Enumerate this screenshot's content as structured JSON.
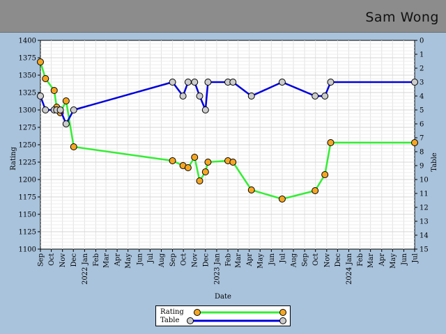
{
  "header": {
    "title": "Sam Wong"
  },
  "chart_data": {
    "type": "line",
    "xlabel": "Date",
    "ylabel_left": "Rating",
    "ylabel_right": "Table",
    "ylim_left": [
      1100,
      1400
    ],
    "ylim_right": [
      15,
      0
    ],
    "y_ticks_left": [
      "1100",
      "1125",
      "1150",
      "1175",
      "1200",
      "1225",
      "1250",
      "1275",
      "1300",
      "1325",
      "1350",
      "1375",
      "1400"
    ],
    "y_ticks_right": [
      "0",
      "1",
      "2",
      "3",
      "4",
      "5",
      "6",
      "7",
      "8",
      "9",
      "10",
      "11",
      "12",
      "13",
      "14",
      "15"
    ],
    "x_range": [
      "2021-09-01",
      "2024-07-01"
    ],
    "x_ticks": [
      {
        "date": "2021-09-01",
        "label": "Sep"
      },
      {
        "date": "2021-10-01",
        "label": "Oct"
      },
      {
        "date": "2021-11-01",
        "label": "Nov"
      },
      {
        "date": "2021-12-01",
        "label": "Dec"
      },
      {
        "date": "2022-01-01",
        "label": "2022 Jan"
      },
      {
        "date": "2022-02-01",
        "label": "Feb"
      },
      {
        "date": "2022-03-01",
        "label": "Mar"
      },
      {
        "date": "2022-04-01",
        "label": "Apr"
      },
      {
        "date": "2022-05-01",
        "label": "May"
      },
      {
        "date": "2022-06-01",
        "label": "Jun"
      },
      {
        "date": "2022-07-01",
        "label": "Jul"
      },
      {
        "date": "2022-08-01",
        "label": "Aug"
      },
      {
        "date": "2022-09-01",
        "label": "Sep"
      },
      {
        "date": "2022-10-01",
        "label": "Oct"
      },
      {
        "date": "2022-11-01",
        "label": "Nov"
      },
      {
        "date": "2022-12-01",
        "label": "Dec"
      },
      {
        "date": "2023-01-01",
        "label": "2023 Jan"
      },
      {
        "date": "2023-02-01",
        "label": "Feb"
      },
      {
        "date": "2023-03-01",
        "label": "Mar"
      },
      {
        "date": "2023-04-01",
        "label": "Apr"
      },
      {
        "date": "2023-05-01",
        "label": "May"
      },
      {
        "date": "2023-06-01",
        "label": "Jun"
      },
      {
        "date": "2023-07-01",
        "label": "Jul"
      },
      {
        "date": "2023-08-01",
        "label": "Aug"
      },
      {
        "date": "2023-09-01",
        "label": "Sep"
      },
      {
        "date": "2023-10-01",
        "label": "Oct"
      },
      {
        "date": "2023-11-01",
        "label": "Nov"
      },
      {
        "date": "2023-12-01",
        "label": "Dec"
      },
      {
        "date": "2024-01-01",
        "label": "2024 Jan"
      },
      {
        "date": "2024-02-01",
        "label": "Feb"
      },
      {
        "date": "2024-03-01",
        "label": "Mar"
      },
      {
        "date": "2024-04-01",
        "label": "Apr"
      },
      {
        "date": "2024-05-01",
        "label": "May"
      },
      {
        "date": "2024-06-01",
        "label": "Jun"
      },
      {
        "date": "2024-07-01",
        "label": "Jul"
      }
    ],
    "grid": true,
    "legend_position": "bottom-center",
    "series": [
      {
        "name": "Rating",
        "axis": "left",
        "color": "#33ee33",
        "marker_color": "#f5a623",
        "points": [
          {
            "date": "2021-09-01",
            "value": 1369
          },
          {
            "date": "2021-09-15",
            "value": 1345
          },
          {
            "date": "2021-10-09",
            "value": 1328
          },
          {
            "date": "2021-10-16",
            "value": 1304
          },
          {
            "date": "2021-10-26",
            "value": 1296
          },
          {
            "date": "2021-11-11",
            "value": 1313
          },
          {
            "date": "2021-12-02",
            "value": 1247
          },
          {
            "date": "2022-09-01",
            "value": 1227
          },
          {
            "date": "2022-09-30",
            "value": 1220
          },
          {
            "date": "2022-10-14",
            "value": 1217
          },
          {
            "date": "2022-11-01",
            "value": 1232
          },
          {
            "date": "2022-11-15",
            "value": 1198
          },
          {
            "date": "2022-12-01",
            "value": 1211
          },
          {
            "date": "2022-12-08",
            "value": 1225
          },
          {
            "date": "2023-02-01",
            "value": 1227
          },
          {
            "date": "2023-02-15",
            "value": 1225
          },
          {
            "date": "2023-04-07",
            "value": 1185
          },
          {
            "date": "2023-07-01",
            "value": 1172
          },
          {
            "date": "2023-09-30",
            "value": 1184
          },
          {
            "date": "2023-10-27",
            "value": 1207
          },
          {
            "date": "2023-11-12",
            "value": 1253
          },
          {
            "date": "2024-07-01",
            "value": 1253
          }
        ]
      },
      {
        "name": "Table",
        "axis": "right",
        "color": "#0000dd",
        "marker_color": "#cccccc",
        "points": [
          {
            "date": "2021-09-01",
            "value": 4
          },
          {
            "date": "2021-09-15",
            "value": 5
          },
          {
            "date": "2021-10-09",
            "value": 5
          },
          {
            "date": "2021-10-16",
            "value": 5
          },
          {
            "date": "2021-10-26",
            "value": 5
          },
          {
            "date": "2021-11-11",
            "value": 6
          },
          {
            "date": "2021-12-02",
            "value": 5
          },
          {
            "date": "2022-09-01",
            "value": 3
          },
          {
            "date": "2022-09-30",
            "value": 4
          },
          {
            "date": "2022-10-14",
            "value": 3
          },
          {
            "date": "2022-11-01",
            "value": 3
          },
          {
            "date": "2022-11-15",
            "value": 4
          },
          {
            "date": "2022-12-01",
            "value": 5
          },
          {
            "date": "2022-12-08",
            "value": 3
          },
          {
            "date": "2023-02-01",
            "value": 3
          },
          {
            "date": "2023-02-15",
            "value": 3
          },
          {
            "date": "2023-04-07",
            "value": 4
          },
          {
            "date": "2023-07-01",
            "value": 3
          },
          {
            "date": "2023-09-30",
            "value": 4
          },
          {
            "date": "2023-10-27",
            "value": 4
          },
          {
            "date": "2023-11-12",
            "value": 3
          },
          {
            "date": "2024-07-01",
            "value": 3
          }
        ]
      }
    ]
  }
}
